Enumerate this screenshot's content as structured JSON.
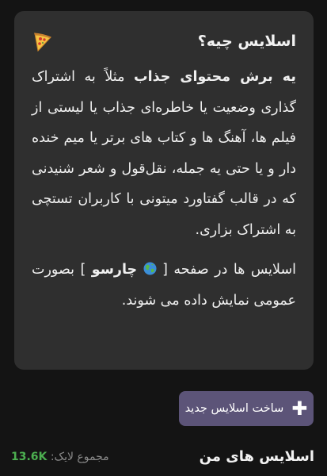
{
  "card": {
    "title": "اسلایس چیه؟",
    "icon": "pizza-icon",
    "para1_bold": "یه برش محتوای جذاب",
    "para1_rest": " مثلاً به اشتراک گذاری وضعیت یا خاطره‌ای جذاب یا لیستی از فیلم ها، آهنگ ها و کتاب های برتر یا میم خنده دار و یا حتی یه جمله، نقل‌قول و شعر شنیدنی که در قالب گفتاورد میتونی با کاربران تستچی به اشتراک بزاری.",
    "para2_start": "اسلایس ها در صفحه [ ",
    "para2_bold": "چارسو",
    "para2_end": " ] بصورت عمومی نمایش داده می شوند."
  },
  "create_button": {
    "label": "ساخت اسلایس جدید",
    "icon": "plus-icon"
  },
  "my_slices": {
    "title": "اسلایس های من",
    "likes_label": "مجموع لایک:",
    "likes_value": "13.6K"
  },
  "colors": {
    "background": "#141414",
    "card": "#2f2f2f",
    "button": "#5c5478",
    "likes": "#4caf50"
  }
}
